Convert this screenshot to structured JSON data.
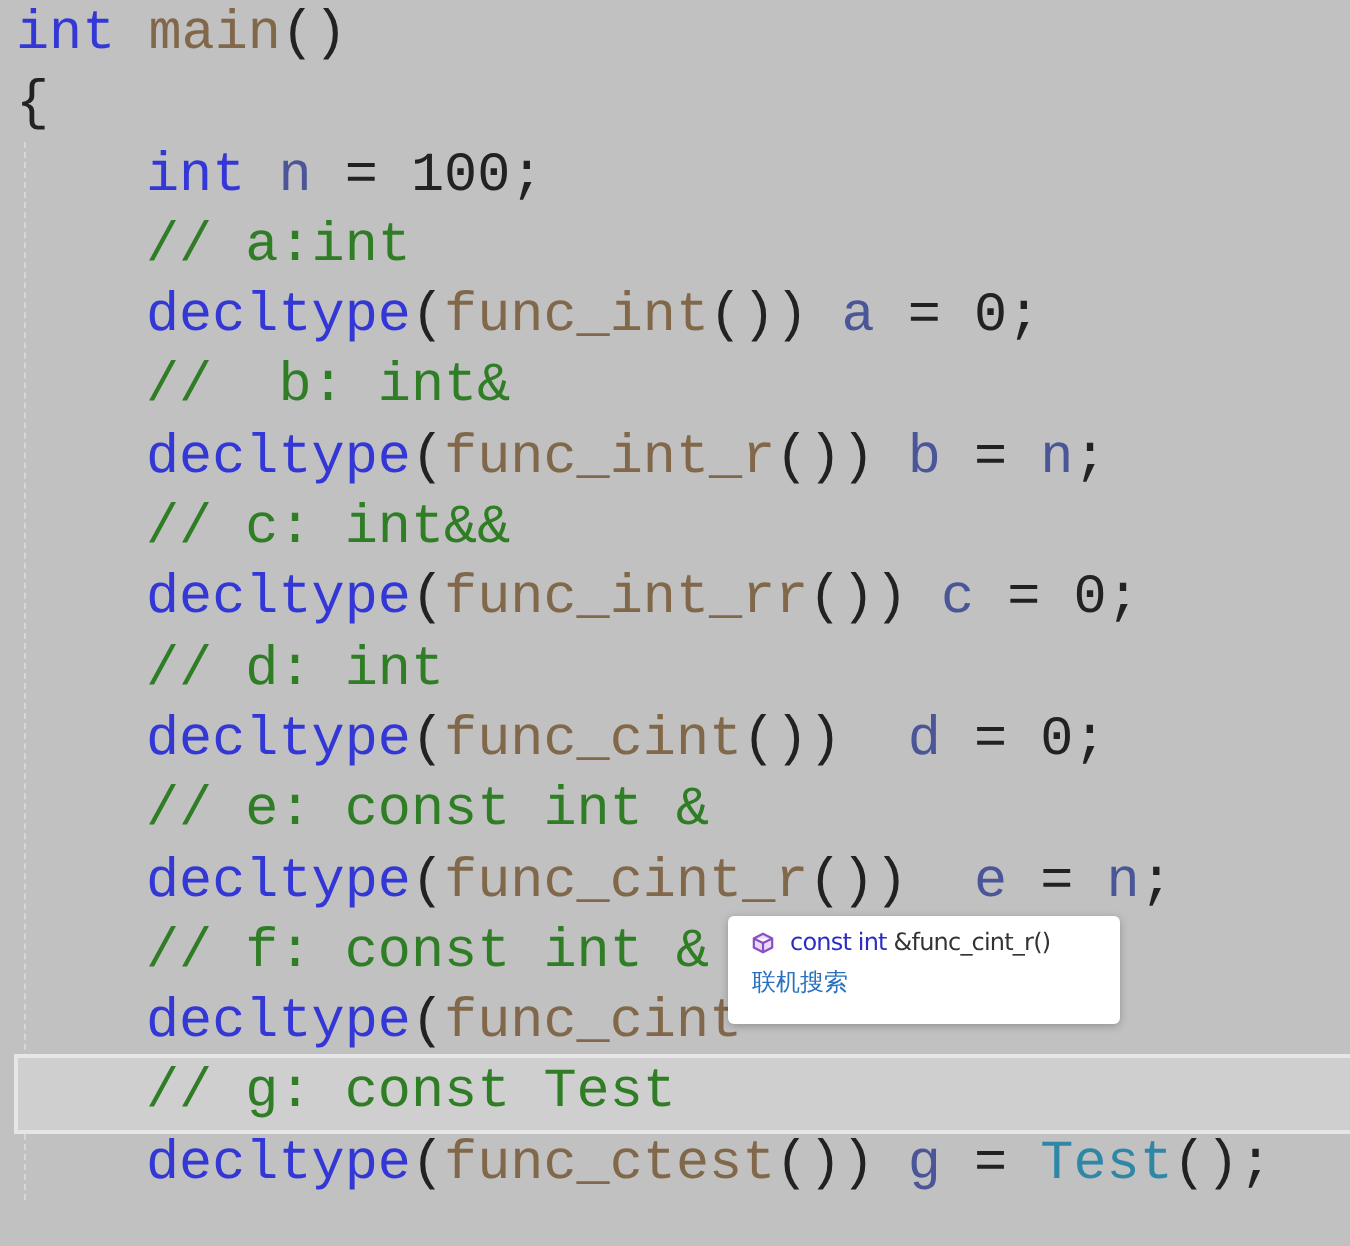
{
  "editor": {
    "lines": [
      {
        "selected": false,
        "tokens": [
          {
            "kind": "keyword",
            "text": "int "
          },
          {
            "kind": "function",
            "text": "main"
          },
          {
            "kind": "plain",
            "text": "()"
          }
        ]
      },
      {
        "selected": false,
        "tokens": [
          {
            "kind": "plain",
            "text": "{"
          }
        ]
      }
    ],
    "body": [
      {
        "selected": false,
        "tokens": [
          {
            "kind": "keyword",
            "text": "int "
          },
          {
            "kind": "variable",
            "text": "n"
          },
          {
            "kind": "plain",
            "text": " = 100;"
          }
        ]
      },
      {
        "selected": false,
        "tokens": [
          {
            "kind": "comment",
            "text": "// a:int"
          }
        ]
      },
      {
        "selected": false,
        "tokens": [
          {
            "kind": "keyword",
            "text": "decltype"
          },
          {
            "kind": "plain",
            "text": "("
          },
          {
            "kind": "function",
            "text": "func_int"
          },
          {
            "kind": "plain",
            "text": "()) "
          },
          {
            "kind": "variable",
            "text": "a"
          },
          {
            "kind": "plain",
            "text": " = 0;"
          }
        ]
      },
      {
        "selected": false,
        "tokens": [
          {
            "kind": "comment",
            "text": "//  b: int&"
          }
        ]
      },
      {
        "selected": false,
        "tokens": [
          {
            "kind": "keyword",
            "text": "decltype"
          },
          {
            "kind": "plain",
            "text": "("
          },
          {
            "kind": "function",
            "text": "func_int_r"
          },
          {
            "kind": "plain",
            "text": "()) "
          },
          {
            "kind": "variable",
            "text": "b"
          },
          {
            "kind": "plain",
            "text": " = "
          },
          {
            "kind": "variable",
            "text": "n"
          },
          {
            "kind": "plain",
            "text": ";"
          }
        ]
      },
      {
        "selected": false,
        "tokens": [
          {
            "kind": "comment",
            "text": "// c: int&&"
          }
        ]
      },
      {
        "selected": false,
        "tokens": [
          {
            "kind": "keyword",
            "text": "decltype"
          },
          {
            "kind": "plain",
            "text": "("
          },
          {
            "kind": "function",
            "text": "func_int_rr"
          },
          {
            "kind": "plain",
            "text": "()) "
          },
          {
            "kind": "variable",
            "text": "c"
          },
          {
            "kind": "plain",
            "text": " = 0;"
          }
        ]
      },
      {
        "selected": false,
        "tokens": [
          {
            "kind": "comment",
            "text": "// d: int"
          }
        ]
      },
      {
        "selected": false,
        "tokens": [
          {
            "kind": "keyword",
            "text": "decltype"
          },
          {
            "kind": "plain",
            "text": "("
          },
          {
            "kind": "function",
            "text": "func_cint"
          },
          {
            "kind": "plain",
            "text": "())  "
          },
          {
            "kind": "variable",
            "text": "d"
          },
          {
            "kind": "plain",
            "text": " = 0;"
          }
        ]
      },
      {
        "selected": false,
        "tokens": [
          {
            "kind": "comment",
            "text": "// e: const int &"
          }
        ]
      },
      {
        "selected": false,
        "tokens": [
          {
            "kind": "keyword",
            "text": "decltype"
          },
          {
            "kind": "plain",
            "text": "("
          },
          {
            "kind": "function",
            "text": "func_cint_r"
          },
          {
            "kind": "plain",
            "text": "())  "
          },
          {
            "kind": "variable",
            "text": "e"
          },
          {
            "kind": "plain",
            "text": " = "
          },
          {
            "kind": "variable",
            "text": "n"
          },
          {
            "kind": "plain",
            "text": ";"
          }
        ]
      },
      {
        "selected": false,
        "tokens": [
          {
            "kind": "comment",
            "text": "// f: const int &"
          }
        ]
      },
      {
        "selected": false,
        "tokens": [
          {
            "kind": "keyword",
            "text": "decltype"
          },
          {
            "kind": "plain",
            "text": "("
          },
          {
            "kind": "function",
            "text": "func_cint"
          }
        ]
      },
      {
        "selected": true,
        "tokens": [
          {
            "kind": "comment",
            "text": "// g: const Test"
          }
        ]
      },
      {
        "selected": false,
        "tokens": [
          {
            "kind": "keyword",
            "text": "decltype"
          },
          {
            "kind": "plain",
            "text": "("
          },
          {
            "kind": "function",
            "text": "func_ctest"
          },
          {
            "kind": "plain",
            "text": "()) "
          },
          {
            "kind": "variable",
            "text": "g"
          },
          {
            "kind": "plain",
            "text": " = "
          },
          {
            "kind": "type",
            "text": "Test"
          },
          {
            "kind": "plain",
            "text": "();"
          }
        ]
      }
    ]
  },
  "tooltip": {
    "signature_type": "const int",
    "signature_rest": "&func_cint_r()",
    "link": "联机搜索"
  }
}
